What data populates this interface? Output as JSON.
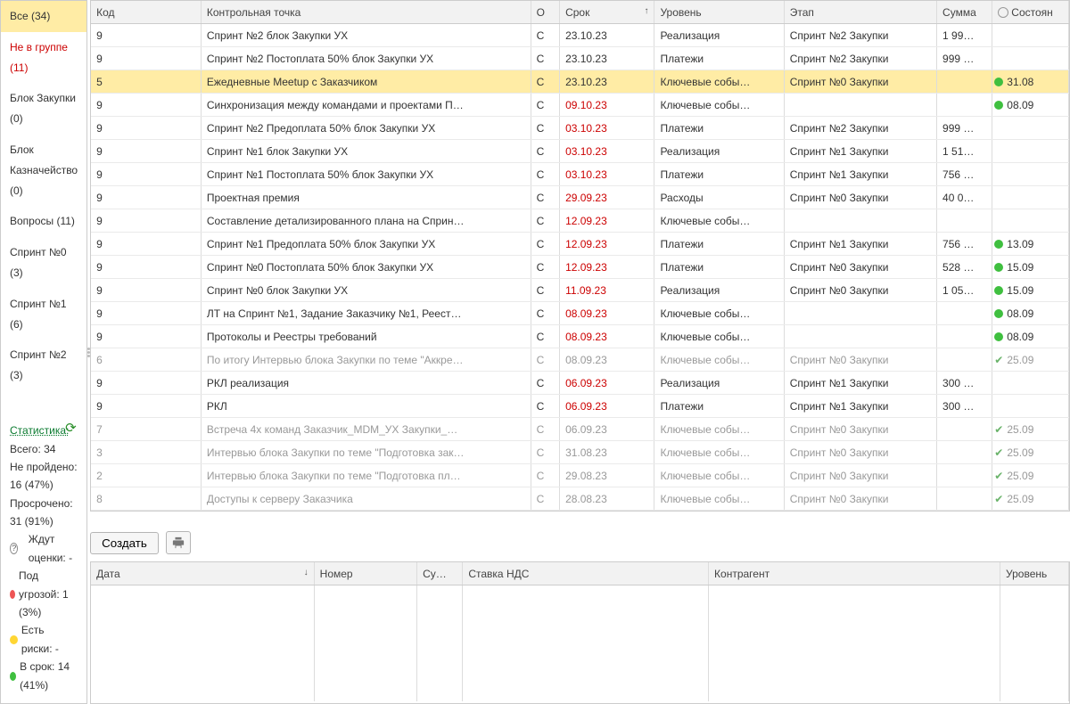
{
  "sidebar": {
    "items": [
      {
        "label": "Все (34)",
        "selected": true
      },
      {
        "label": "Не в группе (11)",
        "cls": "notgroup"
      },
      {
        "label": "Блок Закупки (0)"
      },
      {
        "label": "Блок Казначейство (0)"
      },
      {
        "label": "Вопросы (11)"
      },
      {
        "label": "Спринт №0 (3)"
      },
      {
        "label": "Спринт №1 (6)"
      },
      {
        "label": "Спринт №2 (3)"
      }
    ]
  },
  "stats": {
    "title": "Статистика:",
    "total": "Всего: 34",
    "failed": "Не пройдено: 16 (47%)",
    "overdue": "Просрочено: 31 (91%)",
    "waiting": "Ждут оценки: -",
    "risk_red": "Под угрозой: 1 (3%)",
    "risk_yellow": "Есть риски: -",
    "ontime": "В срок: 14 (41%)"
  },
  "columns": {
    "code": "Код",
    "kp": "Контрольная точка",
    "o": "О",
    "srok": "Срок",
    "ur": "Уровень",
    "etap": "Этап",
    "sum": "Сумма",
    "state": "Состоян"
  },
  "rows": [
    {
      "code": "9",
      "kp": "Спринт №2 блок Закупки УХ",
      "o": "С",
      "srok": "23.10.23",
      "ov": false,
      "ur": "Реализация",
      "etap": "Спринт №2 Закупки",
      "sum": "1 99…",
      "state": "",
      "dot": "",
      "faded": false
    },
    {
      "code": "9",
      "kp": "Спринт №2 Постоплата 50% блок Закупки УХ",
      "o": "С",
      "srok": "23.10.23",
      "ov": false,
      "ur": "Платежи",
      "etap": "Спринт №2 Закупки",
      "sum": "999 …",
      "state": "",
      "dot": "",
      "faded": false
    },
    {
      "code": "5",
      "kp": "Ежедневные Meetup с Заказчиком",
      "o": "С",
      "srok": "23.10.23",
      "ov": false,
      "ur": "Ключевые собы…",
      "etap": "Спринт №0 Закупки",
      "sum": "",
      "state": "31.08",
      "dot": "green",
      "faded": false,
      "selected": true
    },
    {
      "code": "9",
      "kp": "Синхронизация между командами и проектами П…",
      "o": "С",
      "srok": "09.10.23",
      "ov": true,
      "ur": "Ключевые собы…",
      "etap": "",
      "sum": "",
      "state": "08.09",
      "dot": "green",
      "faded": false
    },
    {
      "code": "9",
      "kp": "Спринт №2 Предоплата 50% блок Закупки УХ",
      "o": "С",
      "srok": "03.10.23",
      "ov": true,
      "ur": "Платежи",
      "etap": "Спринт №2 Закупки",
      "sum": "999 …",
      "state": "",
      "dot": "",
      "faded": false
    },
    {
      "code": "9",
      "kp": "Спринт №1 блок Закупки УХ",
      "o": "С",
      "srok": "03.10.23",
      "ov": true,
      "ur": "Реализация",
      "etap": "Спринт №1 Закупки",
      "sum": "1 51…",
      "state": "",
      "dot": "",
      "faded": false
    },
    {
      "code": "9",
      "kp": "Спринт №1 Постоплата 50% блок Закупки УХ",
      "o": "С",
      "srok": "03.10.23",
      "ov": true,
      "ur": "Платежи",
      "etap": "Спринт №1 Закупки",
      "sum": "756 …",
      "state": "",
      "dot": "",
      "faded": false
    },
    {
      "code": "9",
      "kp": "Проектная премия",
      "o": "С",
      "srok": "29.09.23",
      "ov": true,
      "ur": "Расходы",
      "etap": "Спринт №0 Закупки",
      "sum": "40 0…",
      "state": "",
      "dot": "",
      "faded": false
    },
    {
      "code": "9",
      "kp": "Составление детализированного плана на Сприн…",
      "o": "С",
      "srok": "12.09.23",
      "ov": true,
      "ur": "Ключевые собы…",
      "etap": "",
      "sum": "",
      "state": "",
      "dot": "",
      "faded": false
    },
    {
      "code": "9",
      "kp": "Спринт №1 Предоплата 50% блок Закупки УХ",
      "o": "С",
      "srok": "12.09.23",
      "ov": true,
      "ur": "Платежи",
      "etap": "Спринт №1 Закупки",
      "sum": "756 …",
      "state": "13.09",
      "dot": "green",
      "faded": false
    },
    {
      "code": "9",
      "kp": "Спринт №0 Постоплата 50% блок Закупки УХ",
      "o": "С",
      "srok": "12.09.23",
      "ov": true,
      "ur": "Платежи",
      "etap": "Спринт №0 Закупки",
      "sum": "528 …",
      "state": "15.09",
      "dot": "green",
      "faded": false
    },
    {
      "code": "9",
      "kp": "Спринт №0 блок Закупки УХ",
      "o": "С",
      "srok": "11.09.23",
      "ov": true,
      "ur": "Реализация",
      "etap": "Спринт №0 Закупки",
      "sum": "1 05…",
      "state": "15.09",
      "dot": "green",
      "faded": false
    },
    {
      "code": "9",
      "kp": "ЛТ на Спринт №1, Задание Заказчику №1, Реест…",
      "o": "С",
      "srok": "08.09.23",
      "ov": true,
      "ur": "Ключевые собы…",
      "etap": "",
      "sum": "",
      "state": "08.09",
      "dot": "green",
      "faded": false
    },
    {
      "code": "9",
      "kp": "Протоколы и Реестры требований",
      "o": "С",
      "srok": "08.09.23",
      "ov": true,
      "ur": "Ключевые собы…",
      "etap": "",
      "sum": "",
      "state": "08.09",
      "dot": "green",
      "faded": false
    },
    {
      "code": "6",
      "kp": "По итогу Интервью блока Закупки по теме \"Аккре…",
      "o": "С",
      "srok": "08.09.23",
      "ov": false,
      "ur": "Ключевые собы…",
      "etap": "Спринт №0 Закупки",
      "sum": "",
      "state": "25.09",
      "dot": "tick",
      "faded": true
    },
    {
      "code": "9",
      "kp": "РКЛ реализация",
      "o": "С",
      "srok": "06.09.23",
      "ov": true,
      "ur": "Реализация",
      "etap": "Спринт №1 Закупки",
      "sum": "300 …",
      "state": "",
      "dot": "",
      "faded": false
    },
    {
      "code": "9",
      "kp": "РКЛ",
      "o": "С",
      "srok": "06.09.23",
      "ov": true,
      "ur": "Платежи",
      "etap": "Спринт №1 Закупки",
      "sum": "300 …",
      "state": "",
      "dot": "",
      "faded": false
    },
    {
      "code": "7",
      "kp": "Встреча 4х команд Заказчик_MDM_УХ Закупки_…",
      "o": "С",
      "srok": "06.09.23",
      "ov": false,
      "ur": "Ключевые собы…",
      "etap": "Спринт №0 Закупки",
      "sum": "",
      "state": "25.09",
      "dot": "tick",
      "faded": true
    },
    {
      "code": "3",
      "kp": "Интервью блока Закупки по теме \"Подготовка зак…",
      "o": "С",
      "srok": "31.08.23",
      "ov": false,
      "ur": "Ключевые собы…",
      "etap": "Спринт №0 Закупки",
      "sum": "",
      "state": "25.09",
      "dot": "tick",
      "faded": true
    },
    {
      "code": "2",
      "kp": "Интервью блока Закупки по теме \"Подготовка пл…",
      "o": "С",
      "srok": "29.08.23",
      "ov": false,
      "ur": "Ключевые собы…",
      "etap": "Спринт №0 Закупки",
      "sum": "",
      "state": "25.09",
      "dot": "tick",
      "faded": true
    },
    {
      "code": "8",
      "kp": "Доступы к серверу Заказчика",
      "o": "С",
      "srok": "28.08.23",
      "ov": false,
      "ur": "Ключевые собы…",
      "etap": "Спринт №0 Закупки",
      "sum": "",
      "state": "25.09",
      "dot": "tick",
      "faded": true
    }
  ],
  "toolbar": {
    "create": "Создать"
  },
  "bottom_cols": {
    "date": "Дата",
    "num": "Номер",
    "su": "Су…",
    "nds": "Ставка НДС",
    "ka": "Контрагент",
    "ur": "Уровень"
  }
}
